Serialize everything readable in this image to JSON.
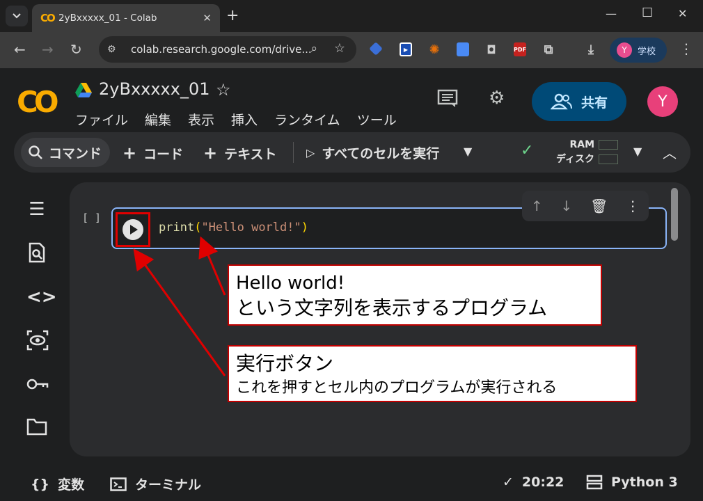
{
  "browser": {
    "tab_title": "2yBxxxxx_01 - Colab",
    "tab_favicon": "CO",
    "url": "colab.research.google.com/drive...",
    "profile_initial": "Y",
    "profile_name": "学校",
    "extension_pdf": "PDF"
  },
  "header": {
    "logo": "CO",
    "notebook_title": "2yBxxxxx_01",
    "menu": [
      "ファイル",
      "編集",
      "表示",
      "挿入",
      "ランタイム",
      "ツール"
    ],
    "share_label": "共有",
    "user_initial": "Y"
  },
  "command_bar": {
    "search_label": "コマンド",
    "add_code": "コード",
    "add_text": "テキスト",
    "run_all": "すべてのセルを実行",
    "ram_label": "RAM",
    "disk_label": "ディスク"
  },
  "cell": {
    "bracket": "[ ]",
    "code_fn": "print",
    "code_open": "(",
    "code_str": "\"Hello world!\"",
    "code_close": ")"
  },
  "annotations": {
    "callout1_line1": "Hello world!",
    "callout1_line2": "という文字列を表示するプログラム",
    "callout2_line1": "実行ボタン",
    "callout2_line2": "これを押すとセル内のプログラムが実行される"
  },
  "status_bar": {
    "variables": "変数",
    "terminal": "ターミナル",
    "time": "20:22",
    "runtime": "Python 3"
  },
  "colors": {
    "accent_blue": "#8ab4f8",
    "share_bg": "#004a77",
    "annotation_red": "#e00000",
    "colab_orange": "#f9ab00"
  }
}
